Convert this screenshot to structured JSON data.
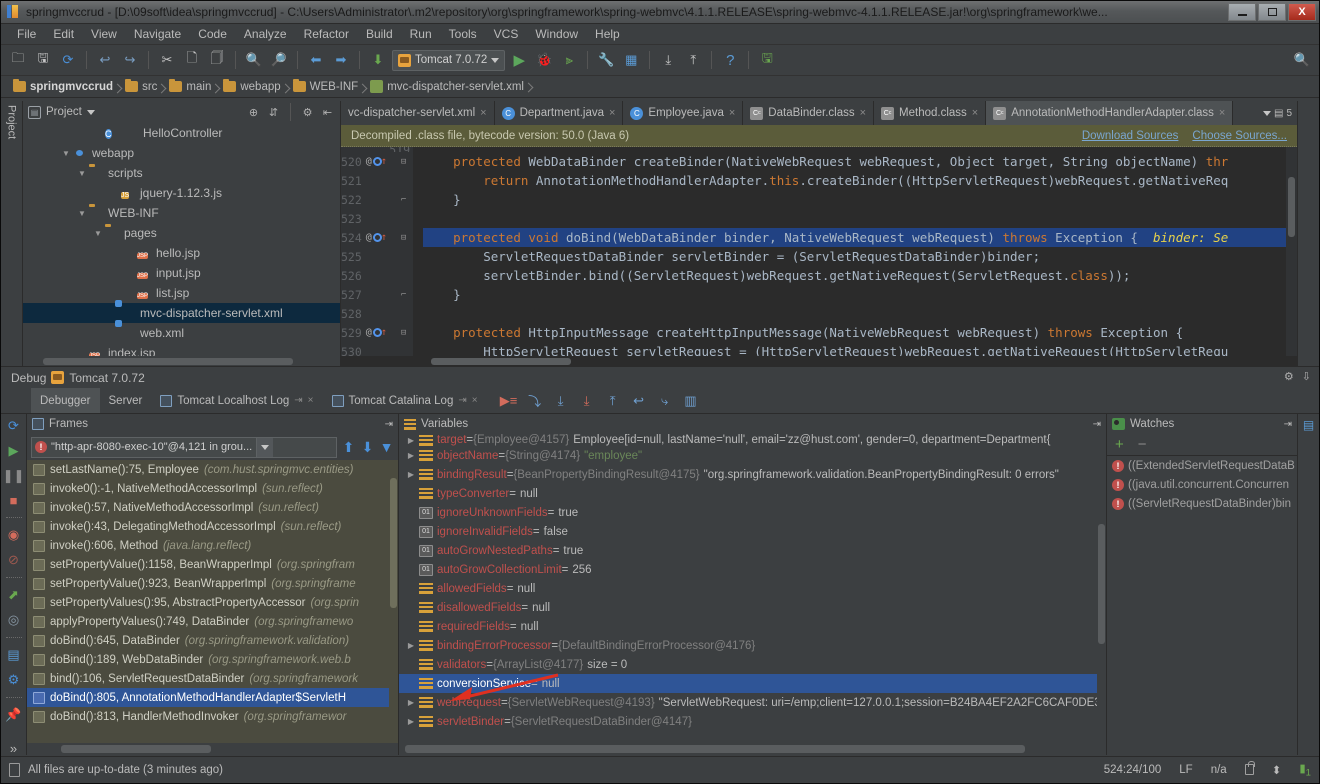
{
  "window": {
    "title": "springmvccrud - [D:\\09soft\\idea\\springmvccrud] - C:\\Users\\Administrator\\.m2\\repository\\org\\springframework\\spring-webmvc\\4.1.1.RELEASE\\spring-webmvc-4.1.1.RELEASE.jar!\\org\\springframework\\we...",
    "minimize": "—",
    "maximize": "▭",
    "close": "X"
  },
  "menu": [
    "File",
    "Edit",
    "View",
    "Navigate",
    "Code",
    "Analyze",
    "Refactor",
    "Build",
    "Run",
    "Tools",
    "VCS",
    "Window",
    "Help"
  ],
  "toolbar": {
    "run_config": "Tomcat 7.0.72",
    "icons": [
      "open-folder-icon",
      "save-all-icon",
      "sync-icon",
      "undo-icon",
      "redo-icon",
      "cut-icon",
      "copy-icon",
      "paste-icon",
      "find-icon",
      "replace-icon",
      "back-icon",
      "forward-icon",
      "compile-icon",
      "run-icon",
      "debug-icon",
      "coverage-icon",
      "settings-icon",
      "project-structure-icon",
      "update-project-icon",
      "commit-icon",
      "help-icon",
      "sdk-manager-icon"
    ]
  },
  "breadcrumb": [
    "springmvccrud",
    "src",
    "main",
    "webapp",
    "WEB-INF",
    "mvc-dispatcher-servlet.xml"
  ],
  "project_panel": {
    "title": "Project",
    "tree": [
      {
        "indent": 4,
        "arrow": "",
        "icon": "class-icon",
        "label": "HelloController",
        "selected": false,
        "lock": true
      },
      {
        "indent": 2,
        "arrow": "▼",
        "icon": "webapp-icon",
        "label": "webapp",
        "selected": false
      },
      {
        "indent": 3,
        "arrow": "▼",
        "icon": "folder-icon",
        "label": "scripts",
        "selected": false
      },
      {
        "indent": 5,
        "arrow": "",
        "icon": "js-icon",
        "label": "jquery-1.12.3.js",
        "selected": false
      },
      {
        "indent": 3,
        "arrow": "▼",
        "icon": "folder-icon",
        "label": "WEB-INF",
        "selected": false
      },
      {
        "indent": 4,
        "arrow": "▼",
        "icon": "folder-icon",
        "label": "pages",
        "selected": false
      },
      {
        "indent": 6,
        "arrow": "",
        "icon": "jsp-icon",
        "label": "hello.jsp",
        "selected": false
      },
      {
        "indent": 6,
        "arrow": "",
        "icon": "jsp-icon",
        "label": "input.jsp",
        "selected": false
      },
      {
        "indent": 6,
        "arrow": "",
        "icon": "jsp-icon",
        "label": "list.jsp",
        "selected": false
      },
      {
        "indent": 5,
        "arrow": "",
        "icon": "xml-icon",
        "label": "mvc-dispatcher-servlet.xml",
        "selected": true
      },
      {
        "indent": 5,
        "arrow": "",
        "icon": "xml-icon",
        "label": "web.xml",
        "selected": false
      },
      {
        "indent": 3,
        "arrow": "",
        "icon": "jsp-icon",
        "label": "index.jsp",
        "selected": false
      }
    ]
  },
  "editor": {
    "tabs": [
      {
        "label": "vc-dispatcher-servlet.xml",
        "icon": "xml-icon",
        "active": false,
        "truncated": true
      },
      {
        "label": "Department.java",
        "icon": "class-icon",
        "active": false
      },
      {
        "label": "Employee.java",
        "icon": "class-icon",
        "active": false
      },
      {
        "label": "DataBinder.class",
        "icon": "classfile-icon",
        "active": false
      },
      {
        "label": "Method.class",
        "icon": "classfile-icon",
        "active": false
      },
      {
        "label": "AnnotationMethodHandlerAdapter.class",
        "icon": "classfile-icon",
        "active": true
      }
    ],
    "tab_overflow_count": "5",
    "notification": {
      "text": "Decompiled .class file, bytecode version: 50.0 (Java 6)",
      "link_download": "Download Sources",
      "link_choose": "Choose Sources..."
    },
    "first_partial_line": "519",
    "lines": [
      {
        "num": "520",
        "marks": true,
        "fold": "minus",
        "highlight": false,
        "segments": [
          {
            "t": "    ",
            "c": "p"
          },
          {
            "t": "protected",
            "c": "kw"
          },
          {
            "t": " WebDataBinder createBinder(NativeWebRequest webRequest, Object target, String objectName) ",
            "c": "p"
          },
          {
            "t": "thr",
            "c": "kw"
          }
        ]
      },
      {
        "num": "521",
        "marks": false,
        "fold": "",
        "highlight": false,
        "segments": [
          {
            "t": "        ",
            "c": "p"
          },
          {
            "t": "return",
            "c": "kw"
          },
          {
            "t": " AnnotationMethodHandlerAdapter.",
            "c": "p"
          },
          {
            "t": "this",
            "c": "kw"
          },
          {
            "t": ".createBinder((HttpServletRequest)webRequest.getNativeReq",
            "c": "p"
          }
        ]
      },
      {
        "num": "522",
        "marks": false,
        "fold": "end",
        "highlight": false,
        "segments": [
          {
            "t": "    }",
            "c": "p"
          }
        ]
      },
      {
        "num": "523",
        "marks": false,
        "fold": "",
        "highlight": false,
        "segments": [
          {
            "t": "",
            "c": "p"
          }
        ]
      },
      {
        "num": "524",
        "marks": true,
        "fold": "minus",
        "highlight": true,
        "segments": [
          {
            "t": "    ",
            "c": "p"
          },
          {
            "t": "protected void",
            "c": "kw"
          },
          {
            "t": " doBind(WebDataBinder binder, NativeWebRequest webRequest) ",
            "c": "p"
          },
          {
            "t": "throws",
            "c": "kw"
          },
          {
            "t": " Exception {  ",
            "c": "p"
          },
          {
            "t": "binder: Se",
            "c": "hint"
          }
        ]
      },
      {
        "num": "525",
        "marks": false,
        "fold": "",
        "highlight": false,
        "segments": [
          {
            "t": "        ServletRequestDataBinder servletBinder = (ServletRequestDataBinder)binder;",
            "c": "p"
          }
        ]
      },
      {
        "num": "526",
        "marks": false,
        "fold": "",
        "highlight": false,
        "segments": [
          {
            "t": "        servletBinder.bind((ServletRequest)webRequest.getNativeRequest(ServletRequest.",
            "c": "p"
          },
          {
            "t": "class",
            "c": "kw"
          },
          {
            "t": "));",
            "c": "p"
          }
        ]
      },
      {
        "num": "527",
        "marks": false,
        "fold": "end",
        "highlight": false,
        "segments": [
          {
            "t": "    }",
            "c": "p"
          }
        ]
      },
      {
        "num": "528",
        "marks": false,
        "fold": "",
        "highlight": false,
        "segments": [
          {
            "t": "",
            "c": "p"
          }
        ]
      },
      {
        "num": "529",
        "marks": true,
        "fold": "minus",
        "highlight": false,
        "segments": [
          {
            "t": "    ",
            "c": "p"
          },
          {
            "t": "protected",
            "c": "kw"
          },
          {
            "t": " HttpInputMessage createHttpInputMessage(NativeWebRequest webRequest) ",
            "c": "p"
          },
          {
            "t": "throws",
            "c": "kw"
          },
          {
            "t": " Exception {",
            "c": "p"
          }
        ]
      },
      {
        "num": "530",
        "marks": false,
        "fold": "",
        "highlight": false,
        "segments": [
          {
            "t": "        HttpServletRequest servletRequest = (HttpServletRequest)webRequest.getNativeRequest(HttpServletRequ",
            "c": "p"
          }
        ]
      }
    ]
  },
  "debug": {
    "header_title": "Debug",
    "header_config": "Tomcat 7.0.72",
    "tabs": [
      {
        "label": "Debugger",
        "active": true,
        "icon": ""
      },
      {
        "label": "Server",
        "active": false,
        "icon": ""
      },
      {
        "label": "Tomcat Localhost Log",
        "active": false,
        "icon": "console-icon",
        "pin": "⇥",
        "close": "×"
      },
      {
        "label": "Tomcat Catalina Log",
        "active": false,
        "icon": "console-icon",
        "pin": "⇥",
        "close": "×"
      }
    ],
    "step_icons": [
      "show-execution-point-icon",
      "step-over-icon",
      "step-into-icon",
      "force-step-into-icon",
      "step-out-icon",
      "drop-frame-icon",
      "run-to-cursor-icon",
      "evaluate-expression-icon"
    ],
    "side_icons": [
      "rerun-icon",
      "resume-icon",
      "pause-icon",
      "stop-icon",
      "view-breakpoints-icon",
      "mute-breakpoints-icon",
      "restore-layout-icon",
      "settings-icon",
      "screenshot-icon",
      "layout-icon",
      "gear-icon",
      "pin-icon",
      "more-icon"
    ],
    "frames": {
      "title": "Frames",
      "thread": "\"http-apr-8080-exec-10\"@4,121 in grou...",
      "items": [
        {
          "method": "setLastName():75, Employee",
          "pkg": "(com.hust.springmvc.entities)",
          "selected": false
        },
        {
          "method": "invoke0():-1, NativeMethodAccessorImpl",
          "pkg": "(sun.reflect)",
          "selected": false
        },
        {
          "method": "invoke():57, NativeMethodAccessorImpl",
          "pkg": "(sun.reflect)",
          "selected": false
        },
        {
          "method": "invoke():43, DelegatingMethodAccessorImpl",
          "pkg": "(sun.reflect)",
          "selected": false
        },
        {
          "method": "invoke():606, Method",
          "pkg": "(java.lang.reflect)",
          "selected": false
        },
        {
          "method": "setPropertyValue():1158, BeanWrapperImpl",
          "pkg": "(org.springfram",
          "selected": false
        },
        {
          "method": "setPropertyValue():923, BeanWrapperImpl",
          "pkg": "(org.springframe",
          "selected": false
        },
        {
          "method": "setPropertyValues():95, AbstractPropertyAccessor",
          "pkg": "(org.sprin",
          "selected": false
        },
        {
          "method": "applyPropertyValues():749, DataBinder",
          "pkg": "(org.springframewo",
          "selected": false
        },
        {
          "method": "doBind():645, DataBinder",
          "pkg": "(org.springframework.validation)",
          "selected": false
        },
        {
          "method": "doBind():189, WebDataBinder",
          "pkg": "(org.springframework.web.b",
          "selected": false
        },
        {
          "method": "bind():106, ServletRequestDataBinder",
          "pkg": "(org.springframework",
          "selected": false
        },
        {
          "method": "doBind():805, AnnotationMethodHandlerAdapter$ServletH",
          "pkg": "",
          "selected": true
        },
        {
          "method": "doBind():813, HandlerMethodInvoker",
          "pkg": "(org.springframewor",
          "selected": false
        }
      ]
    },
    "variables": {
      "title": "Variables",
      "items": [
        {
          "tri": "▶",
          "icon": "object-icon",
          "name": "target",
          "eq": " = ",
          "ref": "{Employee@4157}",
          "value": "Employee[id=null, lastName='null', email='zz@hust.com', gender=0, department=Department{",
          "value_type": "plain",
          "clipped": true,
          "selected": false
        },
        {
          "tri": "▶",
          "icon": "object-icon",
          "name": "objectName",
          "eq": " = ",
          "ref": "{String@4174}",
          "value": "\"employee\"",
          "value_type": "string",
          "selected": false
        },
        {
          "tri": "▶",
          "icon": "object-icon",
          "name": "bindingResult",
          "eq": " = ",
          "ref": "{BeanPropertyBindingResult@4175}",
          "value": "\"org.springframework.validation.BeanPropertyBindingResult: 0 errors\"",
          "value_type": "plain",
          "selected": false
        },
        {
          "tri": "",
          "icon": "object-icon",
          "name": "typeConverter",
          "eq": " = ",
          "ref": "",
          "value": "null",
          "value_type": "plain",
          "selected": false
        },
        {
          "tri": "",
          "icon": "primitive-icon",
          "name": "ignoreUnknownFields",
          "eq": " = ",
          "ref": "",
          "value": "true",
          "value_type": "plain",
          "selected": false
        },
        {
          "tri": "",
          "icon": "primitive-icon",
          "name": "ignoreInvalidFields",
          "eq": " = ",
          "ref": "",
          "value": "false",
          "value_type": "plain",
          "selected": false
        },
        {
          "tri": "",
          "icon": "primitive-icon",
          "name": "autoGrowNestedPaths",
          "eq": " = ",
          "ref": "",
          "value": "true",
          "value_type": "plain",
          "selected": false
        },
        {
          "tri": "",
          "icon": "primitive-icon",
          "name": "autoGrowCollectionLimit",
          "eq": " = ",
          "ref": "",
          "value": "256",
          "value_type": "plain",
          "selected": false
        },
        {
          "tri": "",
          "icon": "object-icon",
          "name": "allowedFields",
          "eq": " = ",
          "ref": "",
          "value": "null",
          "value_type": "plain",
          "selected": false
        },
        {
          "tri": "",
          "icon": "object-icon",
          "name": "disallowedFields",
          "eq": " = ",
          "ref": "",
          "value": "null",
          "value_type": "plain",
          "selected": false
        },
        {
          "tri": "",
          "icon": "object-icon",
          "name": "requiredFields",
          "eq": " = ",
          "ref": "",
          "value": "null",
          "value_type": "plain",
          "selected": false
        },
        {
          "tri": "▶",
          "icon": "object-icon",
          "name": "bindingErrorProcessor",
          "eq": " = ",
          "ref": "{DefaultBindingErrorProcessor@4176}",
          "value": "",
          "value_type": "plain",
          "selected": false
        },
        {
          "tri": "",
          "icon": "object-icon",
          "name": "validators",
          "eq": " = ",
          "ref": "{ArrayList@4177}",
          "value": "size = 0",
          "value_type": "plain",
          "selected": false
        },
        {
          "tri": "",
          "icon": "object-icon",
          "name": "conversionService",
          "eq": " = ",
          "ref": "",
          "value": "null",
          "value_type": "plain",
          "selected": true
        },
        {
          "tri": "▶",
          "icon": "object-icon",
          "name": "webRequest",
          "eq": " = ",
          "ref": "{ServletWebRequest@4193}",
          "value": "\"ServletWebRequest: uri=/emp;client=127.0.0.1;session=B24BA4EF2A2FC6CAF0DE3E",
          "value_type": "plain",
          "selected": false
        },
        {
          "tri": "▶",
          "icon": "object-icon",
          "name": "servletBinder",
          "eq": " = ",
          "ref": "{ServletRequestDataBinder@4147}",
          "value": "",
          "value_type": "plain",
          "selected": false
        }
      ]
    },
    "watches": {
      "title": "Watches",
      "add_label": "+",
      "remove_label": "−",
      "items": [
        "((ExtendedServletRequestDataB",
        "((java.util.concurrent.Concurren",
        "((ServletRequestDataBinder)bin"
      ]
    }
  },
  "status": {
    "message": "All files are up-to-date (3 minutes ago)",
    "position": "524:24/100",
    "line_sep": "LF",
    "encoding": "n/a",
    "lock": "lock-icon",
    "event_count": "1"
  },
  "colors": {
    "accent_selection": "#2f5597",
    "editor_bg": "#2b2b2b",
    "panel_bg": "#3c3f41",
    "notification_bg": "#5b5c3a",
    "frames_bg": "#4b4b3f",
    "annotation_arrow": "#e03020",
    "keyword": "#cc7832",
    "string": "#6a8759"
  }
}
